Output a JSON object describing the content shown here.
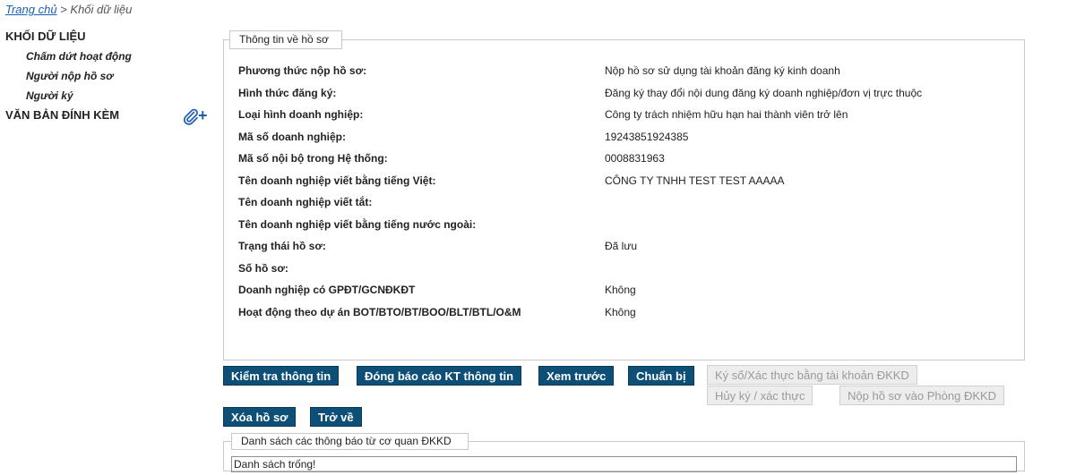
{
  "breadcrumb": {
    "home": "Trang chủ",
    "separator": " > ",
    "current": "Khối dữ liệu"
  },
  "sidebar": {
    "heading": "KHỐI DỮ LIỆU",
    "items": [
      {
        "label": "Chấm dứt hoạt động"
      },
      {
        "label": "Người nộp hồ sơ"
      },
      {
        "label": "Người ký"
      }
    ],
    "attachments_heading": "VĂN BẢN ĐÍNH KÈM",
    "attach_icon": "paperclip-plus-icon"
  },
  "info_panel": {
    "legend": "Thông tin về hồ sơ",
    "rows": [
      {
        "label": "Phương thức nộp hồ sơ:",
        "value": "Nộp hồ sơ sử dụng tài khoản đăng ký kinh doanh"
      },
      {
        "label": "Hình thức đăng ký:",
        "value": "Đăng ký thay đổi nội dung đăng ký doanh nghiệp/đơn vị trực thuộc"
      },
      {
        "label": "Loại hình doanh nghiệp:",
        "value": "Công ty trách nhiệm hữu hạn hai thành viên trở lên"
      },
      {
        "label": "Mã số doanh nghiệp:",
        "value": "19243851924385"
      },
      {
        "label": "Mã số nội bộ trong Hệ thống:",
        "value": "0008831963"
      },
      {
        "label": "Tên doanh nghiệp viết bằng tiếng Việt:",
        "value": "CÔNG TY TNHH TEST TEST AAAAA"
      },
      {
        "label": "Tên doanh nghiệp viết tắt:",
        "value": ""
      },
      {
        "label": "Tên doanh nghiệp viết bằng tiếng nước ngoài:",
        "value": ""
      },
      {
        "label": "Trạng thái hồ sơ:",
        "value": "Đã lưu"
      },
      {
        "label": "Số hồ sơ:",
        "value": ""
      },
      {
        "label": "Doanh nghiệp có GPĐT/GCNĐKĐT",
        "value": "Không"
      },
      {
        "label": "Hoạt động theo dự án BOT/BTO/BT/BOO/BLT/BTL/O&M",
        "value": "Không"
      }
    ]
  },
  "buttons": {
    "check_info": "Kiểm tra thông tin",
    "close_report": "Đóng báo cáo KT thông tin",
    "preview": "Xem trước",
    "prepare": "Chuẩn bị",
    "sign_verify": "Ký số/Xác thực bằng tài khoản ĐKKD",
    "cancel_sign": "Hủy ký / xác thực",
    "submit": "Nộp hồ sơ vào Phòng ĐKKD",
    "delete": "Xóa hồ sơ",
    "back": "Trở về"
  },
  "notices_panel": {
    "legend": "Danh sách các thông báo từ cơ quan ĐKKD",
    "empty_text": "Danh sách trống!"
  },
  "colors": {
    "primary_button": "#0d4f76",
    "link": "#1a5fb4",
    "disabled_button": "#ededed"
  }
}
